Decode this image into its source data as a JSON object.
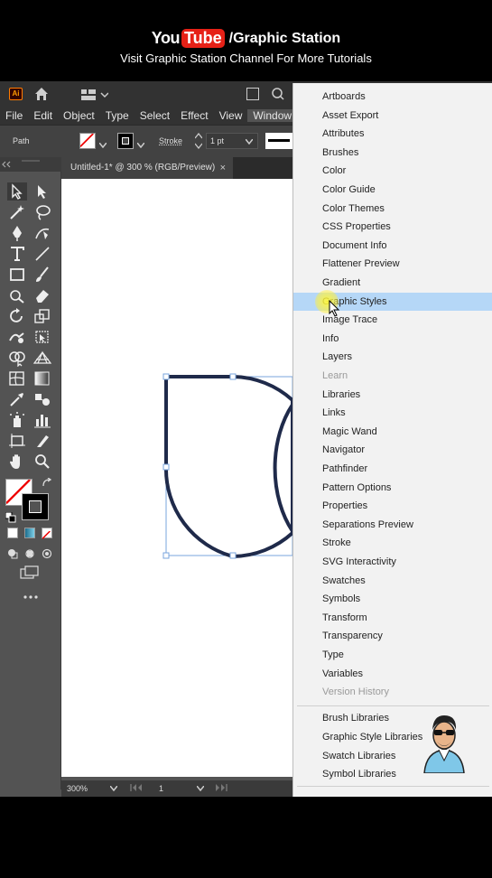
{
  "banner": {
    "brand_you": "You",
    "brand_tube": "Tube",
    "channel": "/Graphic Station",
    "subtitle": "Visit Graphic Station Channel For More Tutorials"
  },
  "appbar": {
    "logo": "Ai"
  },
  "menubar": {
    "items": [
      "File",
      "Edit",
      "Object",
      "Type",
      "Select",
      "Effect",
      "View",
      "Window"
    ]
  },
  "control_bar": {
    "selection_label": "Path",
    "stroke_label": "Stroke",
    "stroke_value": "1 pt"
  },
  "document_tab": {
    "title": "Untitled-1* @ 300 % (RGB/Preview)",
    "close": "×"
  },
  "status_bar": {
    "zoom": "300%",
    "artboard": "1"
  },
  "window_menu": {
    "items": [
      {
        "label": "Artboards",
        "state": "normal"
      },
      {
        "label": "Asset Export",
        "state": "normal"
      },
      {
        "label": "Attributes",
        "state": "normal"
      },
      {
        "label": "Brushes",
        "state": "normal"
      },
      {
        "label": "Color",
        "state": "normal"
      },
      {
        "label": "Color Guide",
        "state": "normal"
      },
      {
        "label": "Color Themes",
        "state": "normal"
      },
      {
        "label": "CSS Properties",
        "state": "normal"
      },
      {
        "label": "Document Info",
        "state": "normal"
      },
      {
        "label": "Flattener Preview",
        "state": "normal"
      },
      {
        "label": "Gradient",
        "state": "normal"
      },
      {
        "label": "Graphic Styles",
        "state": "highlighted"
      },
      {
        "label": "Image Trace",
        "state": "normal"
      },
      {
        "label": "Info",
        "state": "normal"
      },
      {
        "label": "Layers",
        "state": "normal"
      },
      {
        "label": "Learn",
        "state": "disabled"
      },
      {
        "label": "Libraries",
        "state": "normal"
      },
      {
        "label": "Links",
        "state": "normal"
      },
      {
        "label": "Magic Wand",
        "state": "normal"
      },
      {
        "label": "Navigator",
        "state": "normal"
      },
      {
        "label": "Pathfinder",
        "state": "normal"
      },
      {
        "label": "Pattern Options",
        "state": "normal"
      },
      {
        "label": "Properties",
        "state": "normal"
      },
      {
        "label": "Separations Preview",
        "state": "normal"
      },
      {
        "label": "Stroke",
        "state": "normal"
      },
      {
        "label": "SVG Interactivity",
        "state": "normal"
      },
      {
        "label": "Swatches",
        "state": "normal"
      },
      {
        "label": "Symbols",
        "state": "normal"
      },
      {
        "label": "Transform",
        "state": "normal"
      },
      {
        "label": "Transparency",
        "state": "normal"
      },
      {
        "label": "Type",
        "state": "normal"
      },
      {
        "label": "Variables",
        "state": "normal"
      },
      {
        "label": "Version History",
        "state": "disabled"
      }
    ],
    "library_items": [
      {
        "label": "Brush Libraries"
      },
      {
        "label": "Graphic Style Libraries"
      },
      {
        "label": "Swatch Libraries"
      },
      {
        "label": "Symbol Libraries"
      }
    ]
  },
  "colors": {
    "highlight": "#b5d7f7",
    "menu_bg": "#f2f2f2",
    "shape_stroke": "#1f2a4a",
    "selection": "#4a90e2"
  }
}
